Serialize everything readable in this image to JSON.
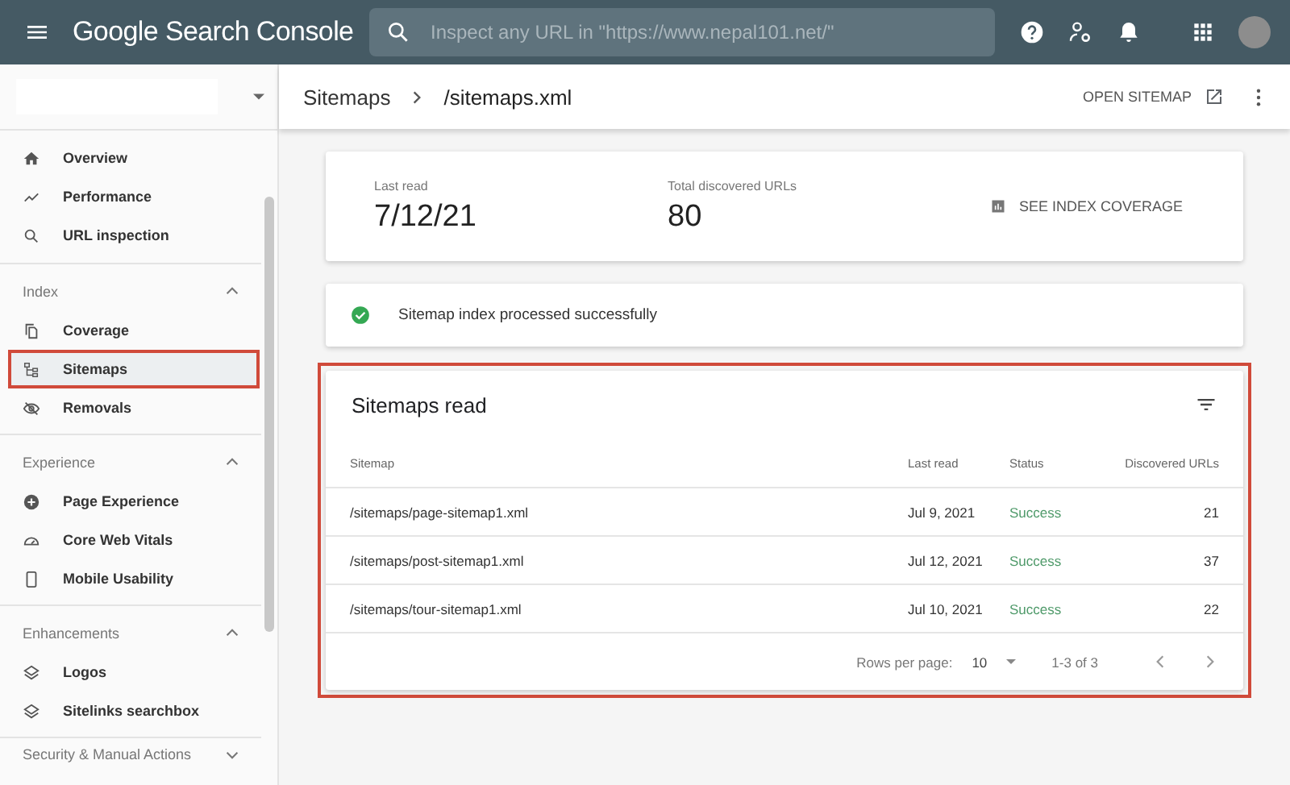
{
  "header": {
    "product": "Google Search Console",
    "search": {
      "placeholder": "Inspect any URL in \"https://www.nepal101.net/\""
    }
  },
  "breadcrumb": {
    "parent": "Sitemaps",
    "current": "/sitemaps.xml",
    "action": "OPEN SITEMAP"
  },
  "sidebar": {
    "sections": [
      {
        "items": [
          {
            "label": "Overview",
            "selected": false,
            "highlighted": false
          },
          {
            "label": "Performance",
            "selected": false,
            "highlighted": false
          },
          {
            "label": "URL inspection",
            "selected": false,
            "highlighted": false
          }
        ]
      },
      {
        "title": "Index",
        "expanded": true,
        "items": [
          {
            "label": "Coverage",
            "selected": false,
            "highlighted": false
          },
          {
            "label": "Sitemaps",
            "selected": true,
            "highlighted": true
          },
          {
            "label": "Removals",
            "selected": false,
            "highlighted": false
          }
        ]
      },
      {
        "title": "Experience",
        "expanded": true,
        "items": [
          {
            "label": "Page Experience",
            "selected": false,
            "highlighted": false
          },
          {
            "label": "Core Web Vitals",
            "selected": false,
            "highlighted": false
          },
          {
            "label": "Mobile Usability",
            "selected": false,
            "highlighted": false
          }
        ]
      },
      {
        "title": "Enhancements",
        "expanded": true,
        "items": [
          {
            "label": "Logos",
            "selected": false,
            "highlighted": false
          },
          {
            "label": "Sitelinks searchbox",
            "selected": false,
            "highlighted": false
          }
        ]
      },
      {
        "title": "Security & Manual Actions",
        "expanded": false
      }
    ]
  },
  "stats": [
    {
      "label": "Last read",
      "value": "7/12/21"
    },
    {
      "label": "Total discovered URLs",
      "value": "80"
    }
  ],
  "coverage_link": "SEE INDEX COVERAGE",
  "status_message": "Sitemap index processed successfully",
  "table": {
    "title": "Sitemaps read",
    "highlighted": true,
    "columns": [
      "Sitemap",
      "Last read",
      "Status",
      "Discovered URLs"
    ],
    "rows": [
      {
        "sitemap": "/sitemaps/page-sitemap1.xml",
        "last_read": "Jul 9, 2021",
        "status": "Success",
        "urls": "21"
      },
      {
        "sitemap": "/sitemaps/post-sitemap1.xml",
        "last_read": "Jul 12, 2021",
        "status": "Success",
        "urls": "37"
      },
      {
        "sitemap": "/sitemaps/tour-sitemap1.xml",
        "last_read": "Jul 10, 2021",
        "status": "Success",
        "urls": "22"
      }
    ],
    "pagination": {
      "rows_label": "Rows per page:",
      "rows_value": "10",
      "range": "1-3 of 3"
    }
  }
}
